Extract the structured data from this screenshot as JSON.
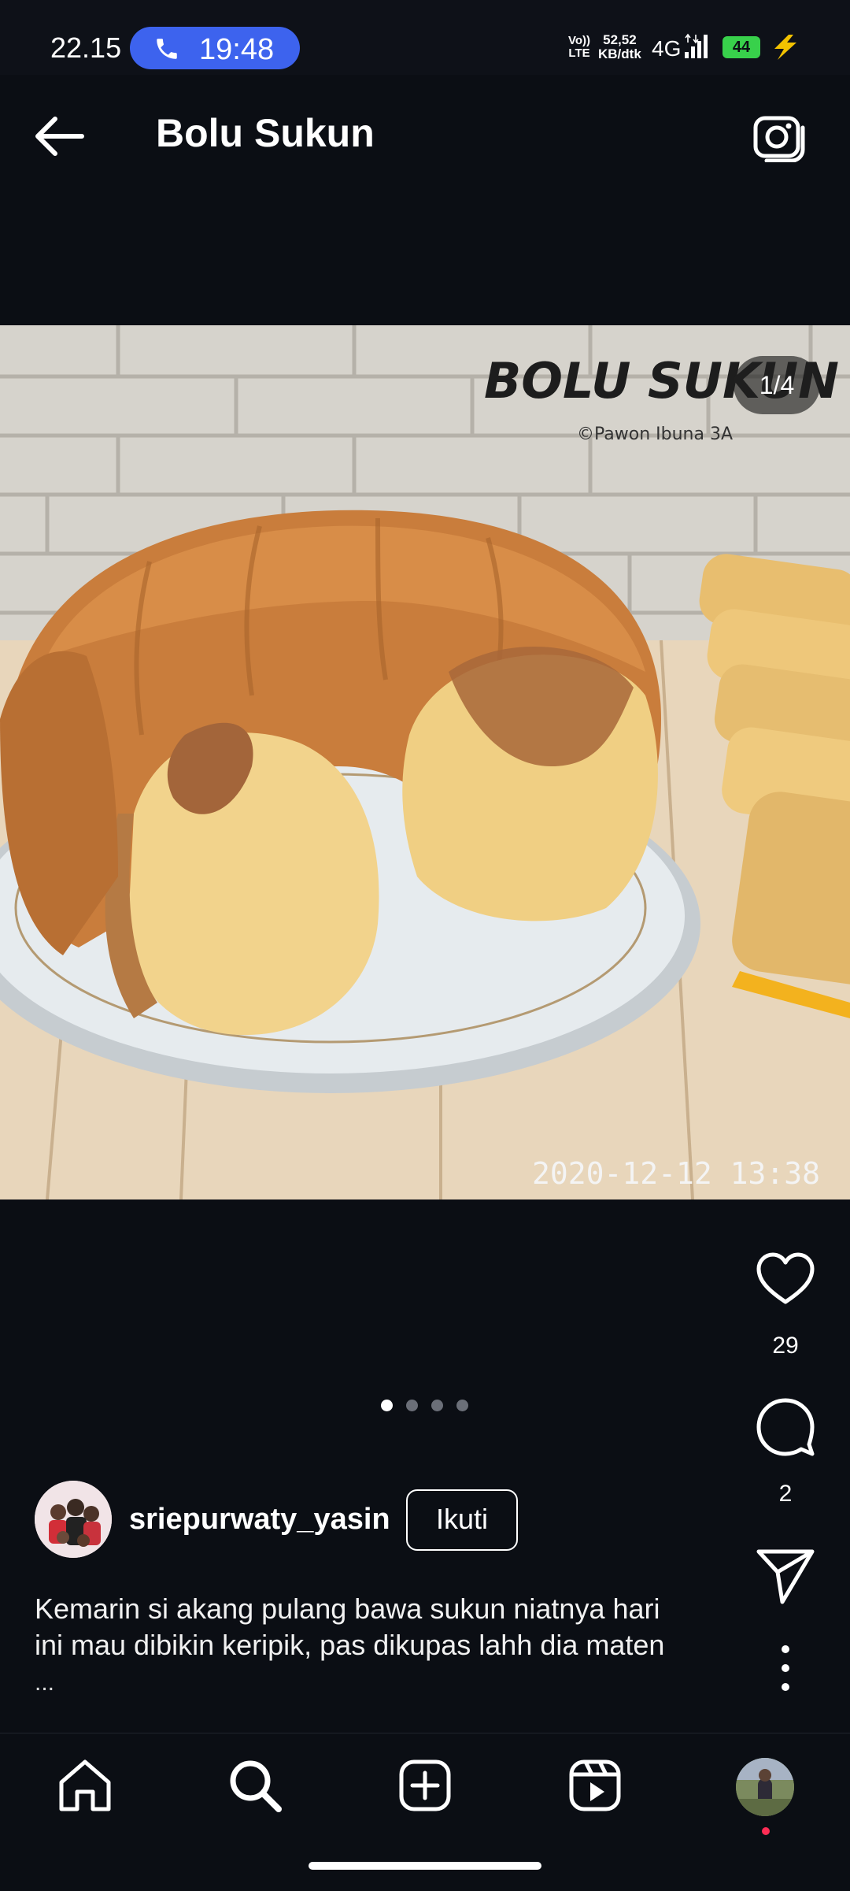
{
  "status_bar": {
    "time": "22.15",
    "call_timer": "19:48",
    "volte_label_1": "Vo))",
    "volte_label_2": "LTE",
    "net_speed_value": "52,52",
    "net_speed_unit": "KB/dtk",
    "network_type": "4G",
    "battery_level": "44",
    "icons": [
      "phone-icon",
      "signal-icon",
      "battery-icon",
      "charging-icon"
    ]
  },
  "header": {
    "title": "Bolu Sukun",
    "back_icon": "back-arrow-icon",
    "camera_icon": "camera-icon"
  },
  "post": {
    "photo_overlay_title": "BOLU SUKUN",
    "photo_overlay_credit": "©Pawon Ibuna 3A",
    "photo_timestamp": "2020-12-12 13:38",
    "counter": "1/4",
    "carousel_total": 4,
    "carousel_active": 1
  },
  "actions": {
    "like_count": "29",
    "comment_count": "2",
    "icons": [
      "heart-icon",
      "comment-icon",
      "share-icon",
      "more-icon"
    ]
  },
  "author": {
    "username": "sriepurwaty_yasin",
    "follow_label": "Ikuti"
  },
  "caption": {
    "line1": "Kemarin si akang pulang bawa sukun niatnya hari",
    "line2": "ini mau dibikin keripik, pas dikupas lahh dia maten",
    "more": "..."
  },
  "bottom_nav": {
    "items": [
      "home-icon",
      "search-icon",
      "create-icon",
      "reels-icon",
      "profile-avatar"
    ]
  },
  "colors": {
    "background": "#0b0e14",
    "call_pill": "#3d63ee",
    "battery": "#38d14b",
    "charging": "#f2c200",
    "notification": "#ff2d55"
  }
}
